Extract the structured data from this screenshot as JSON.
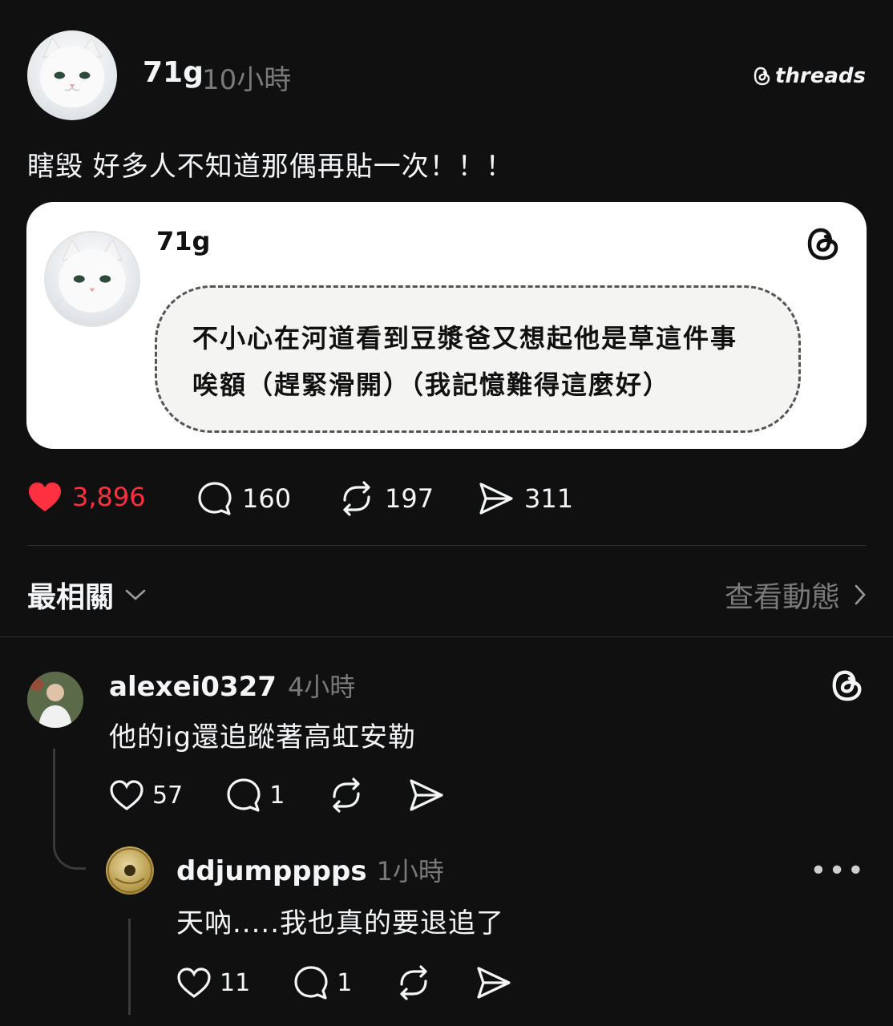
{
  "post": {
    "username": "71g",
    "time": "10小時",
    "brand": "threads",
    "text": "瞎毀 好多人不知道那偶再貼一次！！！"
  },
  "quote": {
    "username": "71g",
    "line1": "不小心在河道看到豆漿爸又想起他是草這件事",
    "line2": "唉額（趕緊滑開）（我記憶難得這麼好）"
  },
  "stats": {
    "likes": "3,896",
    "comments": "160",
    "reposts": "197",
    "shares": "311"
  },
  "filter": {
    "sort_label": "最相關",
    "activity_label": "查看動態"
  },
  "comments": [
    {
      "username": "alexei0327",
      "time": "4小時",
      "text": "他的ig還追蹤著高虹安勒",
      "likes": "57",
      "replies": "1"
    },
    {
      "username": "ddjumpppps",
      "time": "1小時",
      "text": "天吶.....我也真的要退追了",
      "likes": "11",
      "replies": "1"
    }
  ],
  "colors": {
    "background": "#101010",
    "like_red": "#ff3040",
    "muted": "#7a7a7a"
  },
  "icons": [
    "threads-icon",
    "heart-icon",
    "comment-icon",
    "repost-icon",
    "share-icon",
    "chevron-down-icon",
    "chevron-right-icon",
    "more-icon"
  ]
}
